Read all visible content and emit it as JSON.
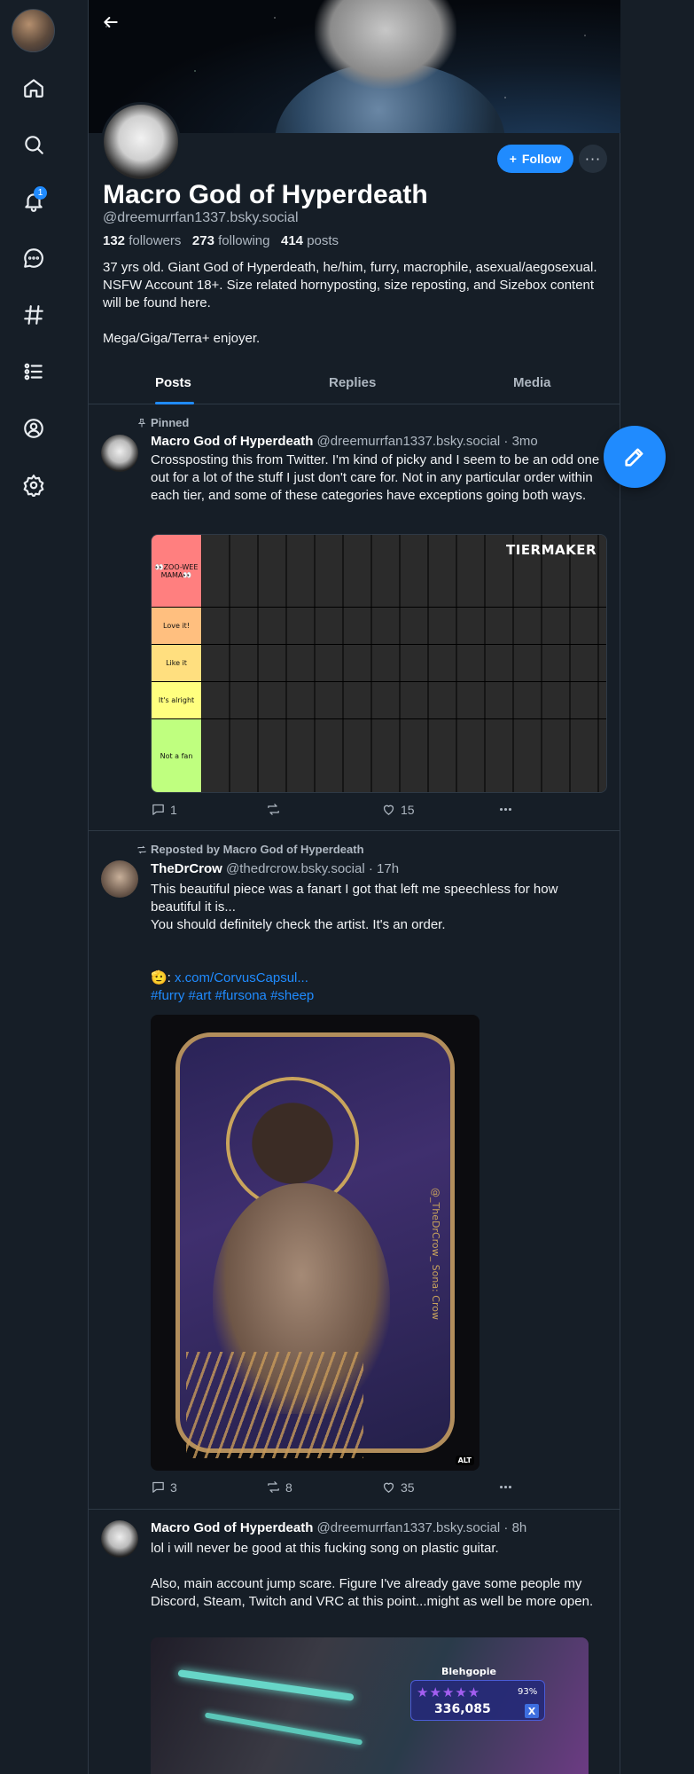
{
  "sidebar": {
    "items": [
      "home",
      "search",
      "notifications",
      "chat",
      "feeds",
      "lists",
      "profile",
      "settings"
    ],
    "notification_count": "1"
  },
  "profile": {
    "display_name": "Macro God of Hyperdeath",
    "handle": "@dreemurrfan1337.bsky.social",
    "followers_count": "132",
    "followers_label": "followers",
    "following_count": "273",
    "following_label": "following",
    "posts_count": "414",
    "posts_label": "posts",
    "bio": "37 yrs old.  Giant God of Hyperdeath, he/him, furry, macrophile, asexual/aegosexual. NSFW Account 18+. Size related hornyposting, size reposting, and Sizebox content will be found here.\n\nMega/Giga/Terra+ enjoyer.",
    "follow_label": "Follow",
    "more_label": "···"
  },
  "tabs": [
    "Posts",
    "Replies",
    "Media"
  ],
  "posts": [
    {
      "reason": "Pinned",
      "author_name": "Macro God of Hyperdeath",
      "author_meta": "@dreemurrfan1337.bsky.social · 3mo",
      "text": "Crossposting this from Twitter. I'm kind of picky and I seem to be an odd one out for a lot of the stuff I just don't care for.  Not in any particular order within each tier, and some of these categories have exceptions going both ways.",
      "tiers": [
        {
          "label": "👀ZOO-WEE MAMA👀",
          "color": "#ff7f7f"
        },
        {
          "label": "Love it!",
          "color": "#ffbf7f"
        },
        {
          "label": "Like it",
          "color": "#ffdf7f"
        },
        {
          "label": "It's alright",
          "color": "#ffff7f"
        },
        {
          "label": "Not a fan",
          "color": "#bfff7f"
        }
      ],
      "image_logo": "TIERMAKER",
      "replies": "1",
      "reposts": "",
      "likes": "15"
    },
    {
      "reason": "Reposted by Macro God of Hyperdeath",
      "author_name": "TheDrCrow",
      "author_meta": "@thedrcrow.bsky.social · 17h",
      "text": "This beautiful piece was a fanart I got that left me speechless for how beautiful it is...\nYou should definitely check the artist. It's an order.",
      "link_prefix": "🫡: ",
      "link_text": "x.com/CorvusCapsul...",
      "hashtags": "#furry #art #fursona #sheep",
      "art_signature": "@_TheDrCrow_  Sona: Crow",
      "alt_label": "ALT",
      "replies": "3",
      "reposts": "8",
      "likes": "35"
    },
    {
      "author_name": "Macro God of Hyperdeath",
      "author_meta": "@dreemurrfan1337.bsky.social · 8h",
      "text": "lol i will never be good at this fucking song on plastic guitar.\n\nAlso, main account jump scare.  Figure I've already gave some people my Discord, Steam, Twitch and VRC at this point...might as well be more open.",
      "game_player": "Blehgopie",
      "game_percent": "93%",
      "game_score": "336,085",
      "game_button": "X"
    }
  ]
}
